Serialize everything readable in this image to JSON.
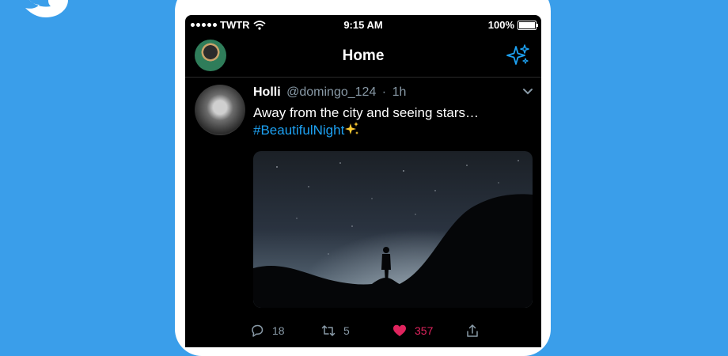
{
  "status_bar": {
    "carrier": "TWTR",
    "time": "9:15 AM",
    "battery": "100%"
  },
  "nav": {
    "title": "Home",
    "sparkle_icon": "sparkle-icon"
  },
  "tweet": {
    "name": "Holli",
    "handle": "@domingo_124",
    "time": "1h",
    "text": "Away from the city and seeing stars…",
    "hashtag": "#BeautifulNight",
    "actions": {
      "replies": "18",
      "retweets": "5",
      "likes": "357"
    }
  },
  "colors": {
    "background": "#3a9eea",
    "link": "#1da1f2",
    "like": "#e0245e",
    "muted": "#8899a6"
  }
}
